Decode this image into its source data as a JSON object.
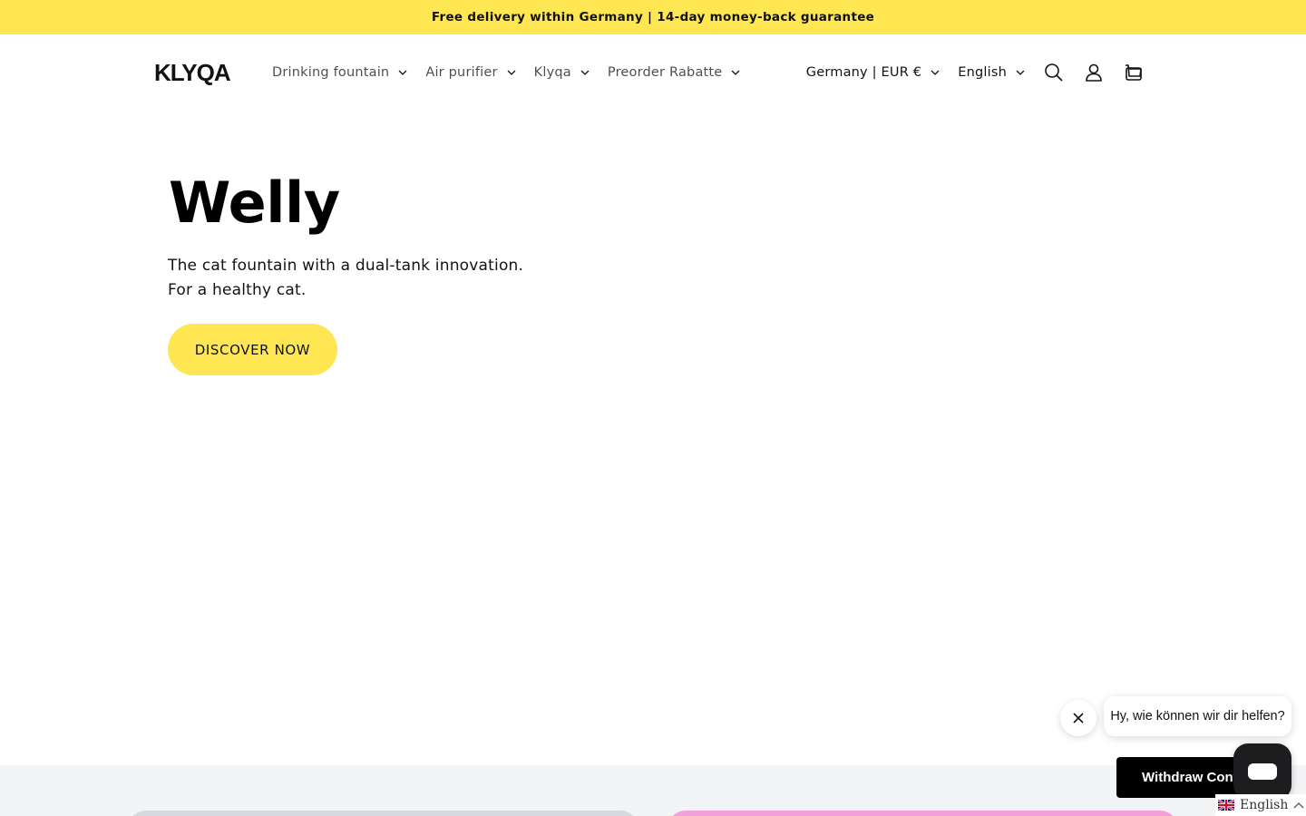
{
  "announcement": {
    "text": "Free delivery within Germany | 14-day money-back guarantee"
  },
  "header": {
    "logo_text": "KLYQA",
    "nav": [
      {
        "label": "Drinking fountain"
      },
      {
        "label": "Air purifier"
      },
      {
        "label": "Klyqa"
      },
      {
        "label": "Preorder Rabatte"
      }
    ],
    "country_selector": "Germany | EUR €",
    "language_selector": "English",
    "icons": [
      "search-icon",
      "account-icon",
      "cart-icon"
    ]
  },
  "hero": {
    "title": "Welly",
    "subtitle_line1": "The cat fountain with a dual-tank innovation.",
    "subtitle_line2": "For a healthy cat.",
    "cta_label": "DISCOVER NOW"
  },
  "chat": {
    "greeting": "Hy, wie können wir dir helfen?",
    "withdraw_label": "Withdraw Contract"
  },
  "language_widget": {
    "label": "English"
  },
  "colors": {
    "accent_yellow": "#ffe653",
    "text": "#121212",
    "section_grey": "#f3f4f6",
    "card_pink": "#f4a0dc",
    "card_grey": "#d7d9de"
  }
}
